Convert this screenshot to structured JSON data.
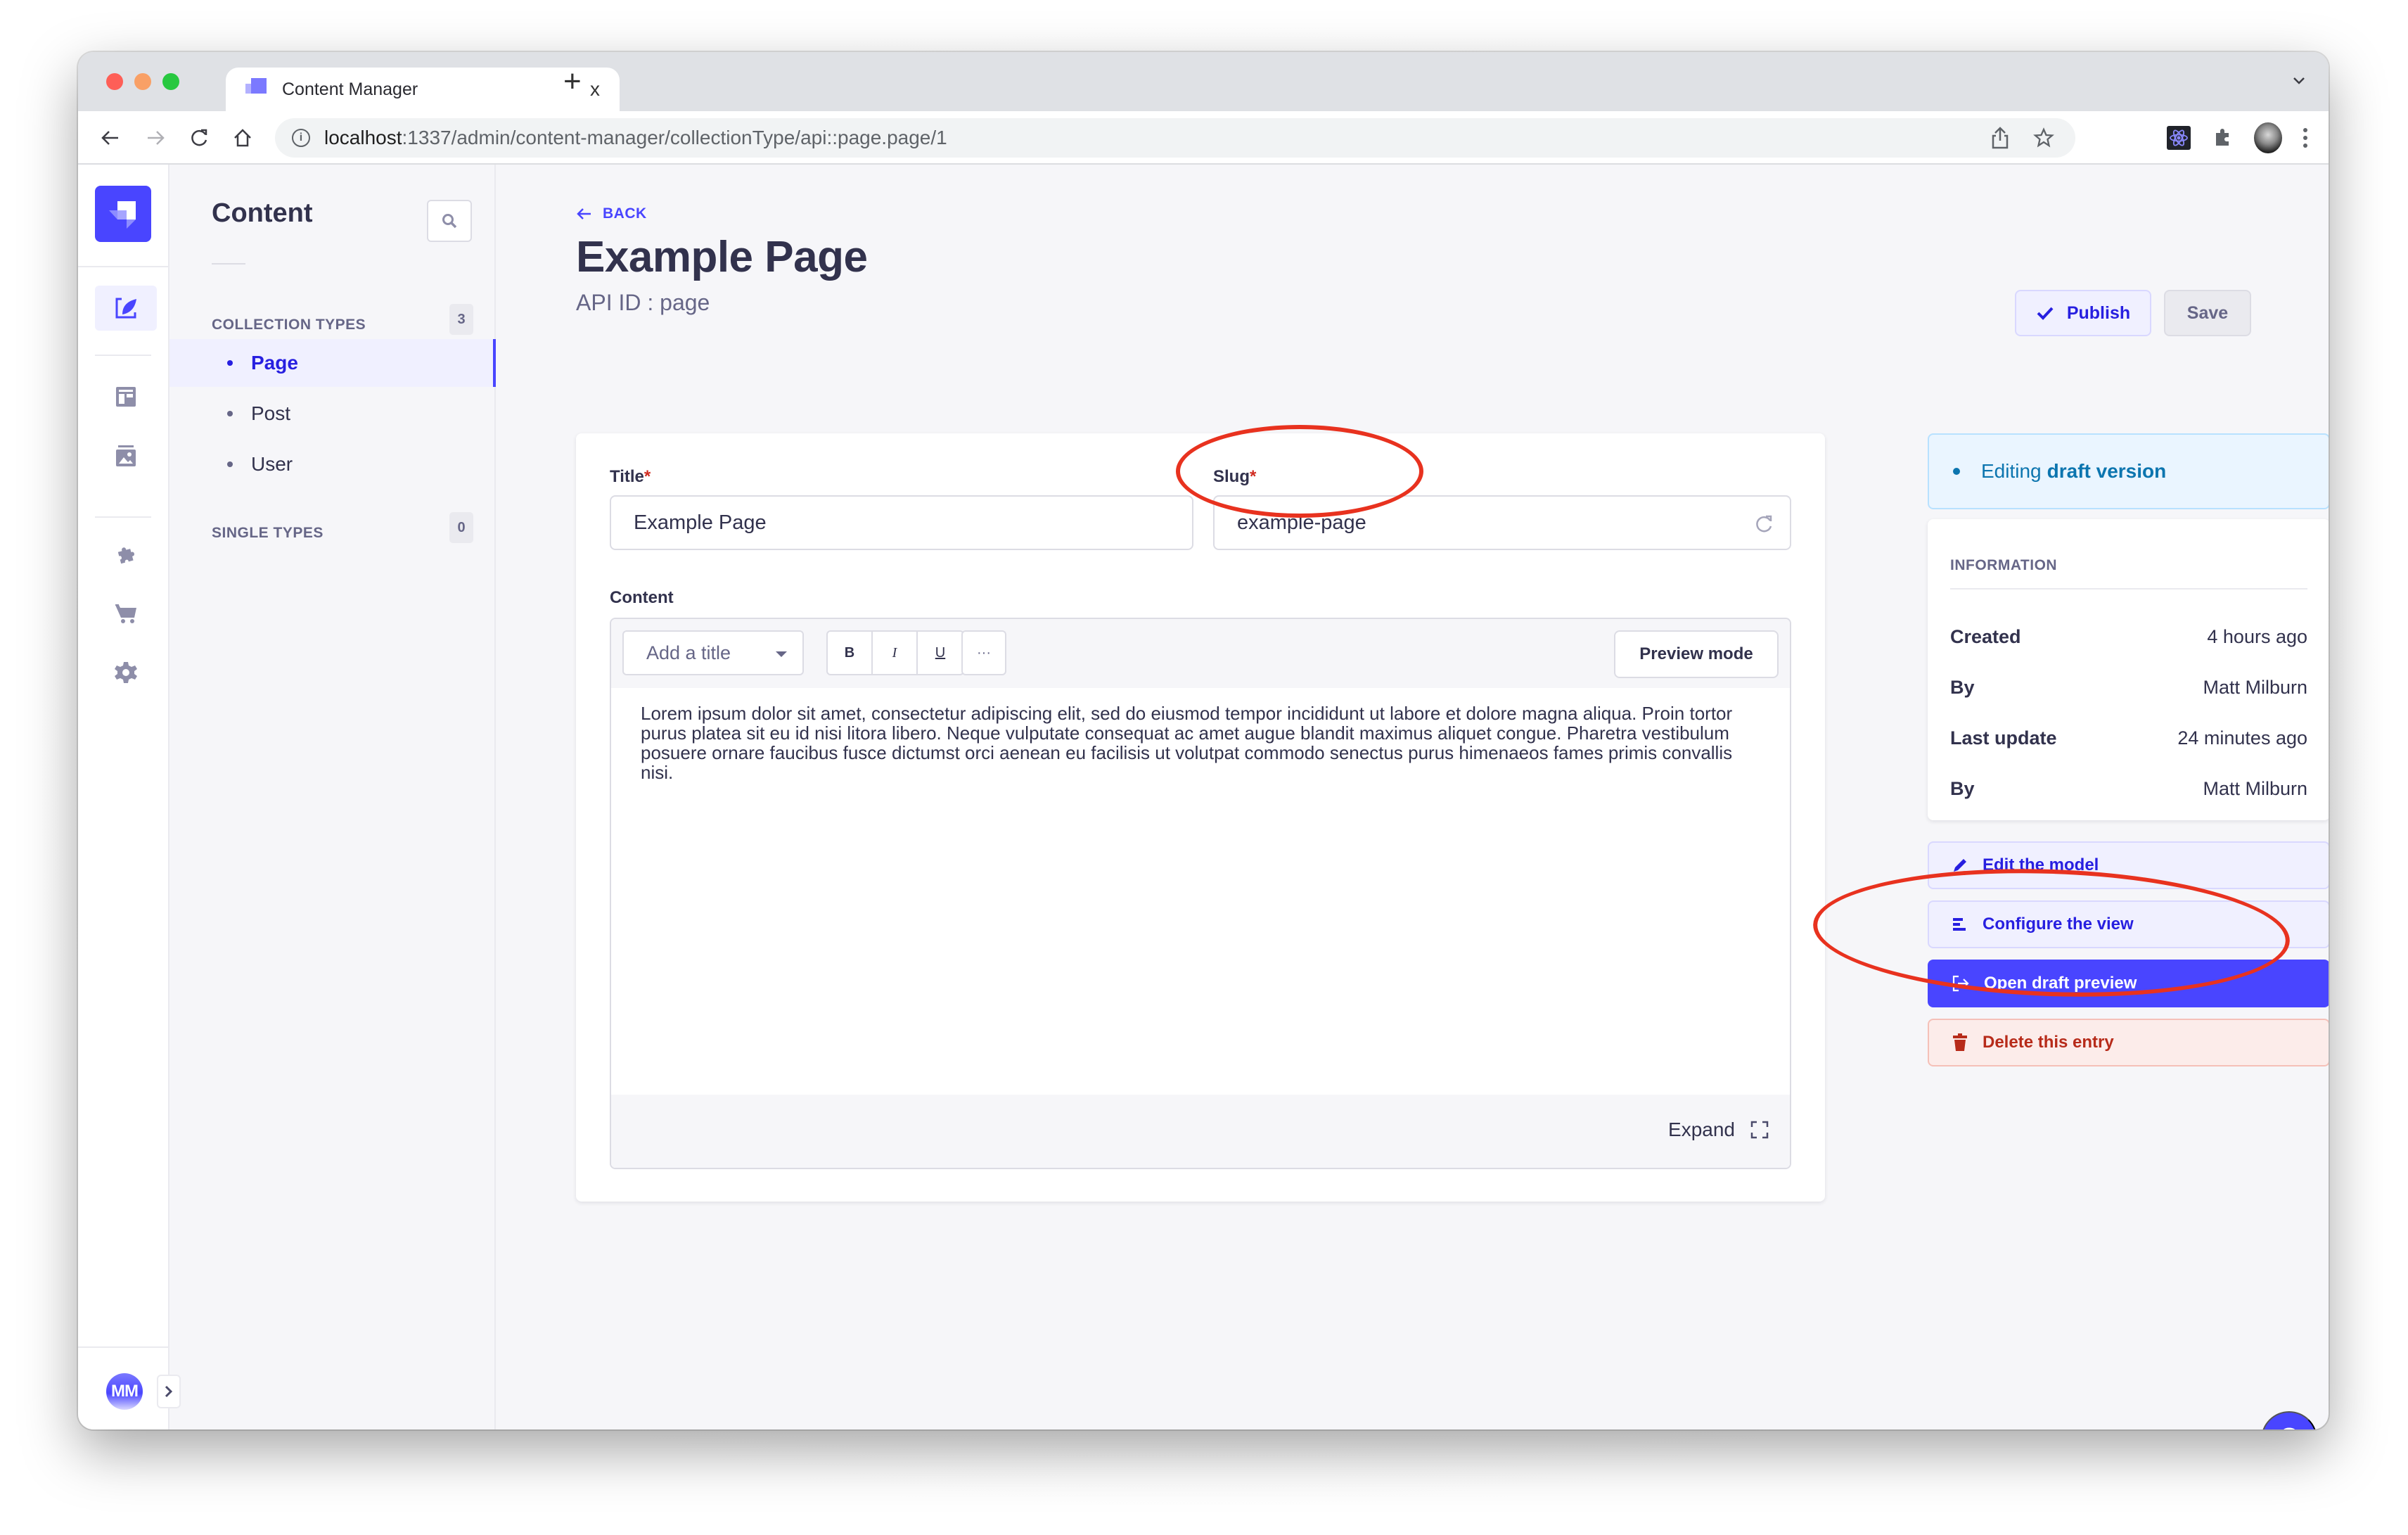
{
  "browser": {
    "tab_title": "Content Manager",
    "tab_close": "x",
    "new_tab": "+",
    "url_host": "localhost",
    "url_path": ":1337/admin/content-manager/collectionType/api::page.page/1",
    "info_glyph": "i"
  },
  "rail": {
    "items": [
      {
        "icon": "content-manager-icon",
        "active": true
      },
      {
        "icon": "content-type-builder-icon",
        "active": false
      },
      {
        "icon": "media-library-icon",
        "active": false
      },
      {
        "icon": "plugins-icon",
        "active": false
      },
      {
        "icon": "marketplace-icon",
        "active": false
      },
      {
        "icon": "settings-icon",
        "active": false
      }
    ],
    "user_initials": "MM"
  },
  "subnav": {
    "title": "Content",
    "collection_types": {
      "label": "Collection Types",
      "count": "3",
      "items": [
        {
          "label": "Page",
          "active": true
        },
        {
          "label": "Post",
          "active": false
        },
        {
          "label": "User",
          "active": false
        }
      ]
    },
    "single_types": {
      "label": "Single Types",
      "count": "0"
    }
  },
  "header": {
    "back_label": "BACK",
    "title": "Example Page",
    "subtitle": "API ID : page",
    "publish_label": "Publish",
    "save_label": "Save"
  },
  "form": {
    "title_label": "Title",
    "title_value": "Example Page",
    "slug_label": "Slug",
    "slug_value": "example-page",
    "required_mark": "*",
    "content_label": "Content",
    "editor": {
      "heading_select": "Add a title",
      "bold": "B",
      "italic": "I",
      "underline": "U",
      "more": "···",
      "preview_mode": "Preview mode",
      "body": "Lorem ipsum dolor sit amet, consectetur adipiscing elit, sed do eiusmod tempor incididunt ut labore et dolore magna aliqua. Proin tortor purus platea sit eu id nisi litora libero. Neque vulputate consequat ac amet augue blandit maximus aliquet congue. Pharetra vestibulum posuere ornare faucibus fusce dictumst orci aenean eu facilisis ut volutpat commodo senectus purus himenaeos fames primis convallis nisi.",
      "expand_label": "Expand"
    }
  },
  "sidebar": {
    "status_prefix": "Editing",
    "status_bold": "draft version",
    "info_title": "INFORMATION",
    "info_rows": [
      {
        "key": "Created",
        "value": "4 hours ago"
      },
      {
        "key": "By",
        "value": "Matt Milburn"
      },
      {
        "key": "Last update",
        "value": "24 minutes ago"
      },
      {
        "key": "By",
        "value": "Matt Milburn"
      }
    ],
    "actions": [
      {
        "label": "Edit the model",
        "icon": "pencil-icon",
        "variant": "soft"
      },
      {
        "label": "Configure the view",
        "icon": "list-icon",
        "variant": "soft"
      },
      {
        "label": "Open draft preview",
        "icon": "external-link-icon",
        "variant": "primary"
      },
      {
        "label": "Delete this entry",
        "icon": "trash-icon",
        "variant": "danger"
      }
    ]
  },
  "help_label": "?",
  "colors": {
    "primary": "#4945ff",
    "primary_dark": "#271fe0",
    "text": "#32324d",
    "muted": "#666687",
    "info": "#0c75af",
    "danger": "#b72b1a",
    "annotation": "#e8321f"
  }
}
